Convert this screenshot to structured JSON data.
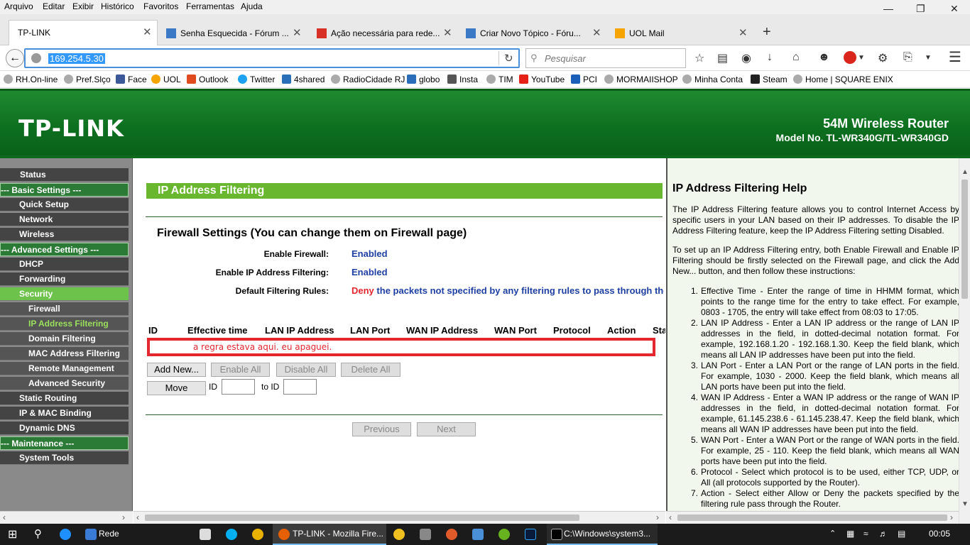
{
  "menubar": {
    "items": [
      "Arquivo",
      "Editar",
      "Exibir",
      "Histórico",
      "Favoritos",
      "Ferramentas",
      "Ajuda"
    ]
  },
  "tabs": [
    {
      "label": "TP-LINK"
    },
    {
      "label": "Senha Esquecida - Fórum ..."
    },
    {
      "label": "Ação necessária para rede..."
    },
    {
      "label": "Criar Novo Tópico - Fóru..."
    },
    {
      "label": "UOL Mail"
    }
  ],
  "new_tab": "+",
  "nav": {
    "url": "169.254.5.30",
    "search_placeholder": "Pesquisar"
  },
  "bookmarks": [
    "RH.On-line",
    "Pref.Slço",
    "Face",
    "UOL",
    "Outlook",
    "Twitter",
    "4shared",
    "RadioCidade RJ",
    "globo",
    "Insta",
    "TIM",
    "YouTube",
    "PCI",
    "MORMAIISHOP",
    "Minha Conta",
    "Steam",
    "Home | SQUARE ENIX"
  ],
  "router": {
    "logo": "TP-LINK",
    "product": "54M Wireless Router",
    "model": "Model No. TL-WR340G/TL-WR340GD"
  },
  "sidebar": {
    "items": [
      {
        "label": "Status",
        "kind": "main"
      },
      {
        "label": "--- Basic Settings ---",
        "kind": "grp"
      },
      {
        "label": "Quick Setup",
        "kind": "main"
      },
      {
        "label": "Network",
        "kind": "main"
      },
      {
        "label": "Wireless",
        "kind": "main"
      },
      {
        "label": "--- Advanced Settings ---",
        "kind": "grp"
      },
      {
        "label": "DHCP",
        "kind": "main"
      },
      {
        "label": "Forwarding",
        "kind": "main"
      },
      {
        "label": "Security",
        "kind": "active"
      },
      {
        "label": "Firewall",
        "kind": "sub"
      },
      {
        "label": "IP Address Filtering",
        "kind": "activeleaf"
      },
      {
        "label": "Domain Filtering",
        "kind": "sub"
      },
      {
        "label": "MAC Address Filtering",
        "kind": "sub"
      },
      {
        "label": "Remote Management",
        "kind": "sub"
      },
      {
        "label": "Advanced Security",
        "kind": "sub"
      },
      {
        "label": "Static Routing",
        "kind": "main"
      },
      {
        "label": "IP & MAC Binding",
        "kind": "main"
      },
      {
        "label": "Dynamic DNS",
        "kind": "main"
      },
      {
        "label": "--- Maintenance ---",
        "kind": "grp"
      },
      {
        "label": "System Tools",
        "kind": "main"
      }
    ]
  },
  "main": {
    "title": "IP Address Filtering",
    "fw_heading": "Firewall Settings (You can change them on Firewall page)",
    "enable_fw_label": "Enable Firewall:",
    "enable_fw_value": "Enabled",
    "enable_ip_label": "Enable IP Address Filtering:",
    "enable_ip_value": "Enabled",
    "default_rules_label": "Default Filtering Rules:",
    "default_rules_deny": "Deny",
    "default_rules_rest": "the packets not specified by any filtering rules to pass through the router",
    "columns": [
      "ID",
      "Effective time",
      "LAN IP Address",
      "LAN Port",
      "WAN IP Address",
      "WAN Port",
      "Protocol",
      "Action",
      "Status"
    ],
    "annotation": "a regra estava aqui. eu apaguei.",
    "buttons": {
      "add": "Add New...",
      "enable_all": "Enable All",
      "disable_all": "Disable All",
      "delete_all": "Delete All",
      "move": "Move",
      "id": "ID",
      "to_id": "to ID",
      "previous": "Previous",
      "next": "Next"
    }
  },
  "help": {
    "title": "IP Address Filtering Help",
    "p1": "The IP Address Filtering feature allows you to control Internet Access by specific users in your LAN based on their IP addresses. To disable the IP Address Filtering feature, keep the IP Address Filtering setting Disabled.",
    "p2": "To set up an IP Address Filtering entry, both Enable Firewall and Enable IP Filtering should be firstly selected on the Firewall page, and click the Add New... button, and then follow these instructions:",
    "items": [
      "Effective Time - Enter the range of time in HHMM format, which points to the range time for the entry to take effect. For example, 0803 - 1705, the entry will take effect from 08:03 to 17:05.",
      "LAN IP Address - Enter a LAN IP address or the range of LAN IP addresses in the field, in dotted-decimal notation format. For example, 192.168.1.20 - 192.168.1.30. Keep the field blank, which means all LAN IP addresses have been put into the field.",
      "LAN Port - Enter a LAN Port or the range of LAN ports in the field. For example, 1030 - 2000. Keep the field blank, which means all LAN ports have been put into the field.",
      "WAN IP Address - Enter a WAN IP address or the range of WAN IP addresses in the field, in dotted-decimal notation format. For example, 61.145.238.6 - 61.145.238.47. Keep the field blank, which means all WAN IP addresses have been put into the field.",
      "WAN Port - Enter a WAN Port or the range of WAN ports in the field. For example, 25 - 110. Keep the field blank, which means all WAN ports have been put into the field.",
      "Protocol - Select which protocol is to be used, either TCP, UDP, or All (all protocols supported by the Router).",
      "Action - Select either Allow or Deny the packets specified by the filtering rule pass through the Router."
    ]
  },
  "taskbar": {
    "search_label": "Rede",
    "firefox": "TP-LINK - Mozilla Fire...",
    "cmd": "C:\\Windows\\system3...",
    "clock": "00:05"
  }
}
